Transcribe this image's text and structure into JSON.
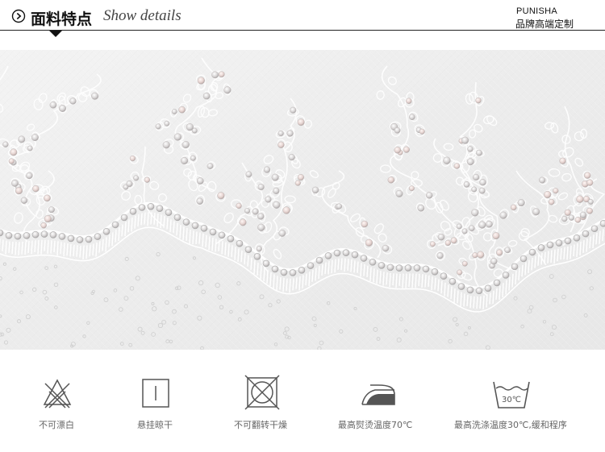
{
  "header": {
    "title_cn": "面料特点",
    "title_en": "Show details",
    "brand": "PUNISHA",
    "brand_sub": "品牌高端定制"
  },
  "photo": {
    "icon": "lace-fabric-photo"
  },
  "care_symbols": [
    {
      "icon": "do-not-bleach-icon",
      "label": "不可漂白"
    },
    {
      "icon": "hang-dry-icon",
      "label": "悬挂晾干"
    },
    {
      "icon": "do-not-tumble-dry-icon",
      "label": "不可翻转干燥"
    },
    {
      "icon": "iron-70c-icon",
      "label": "最高熨烫温度70℃"
    },
    {
      "icon": "wash-30c-icon",
      "label": "最高洗涤温度30℃,缓和程序",
      "tub_text": "30℃"
    }
  ],
  "colors": {
    "text": "#111111",
    "icon": "#555555",
    "label": "#666666",
    "fabric_bg": "#eeeeee"
  }
}
